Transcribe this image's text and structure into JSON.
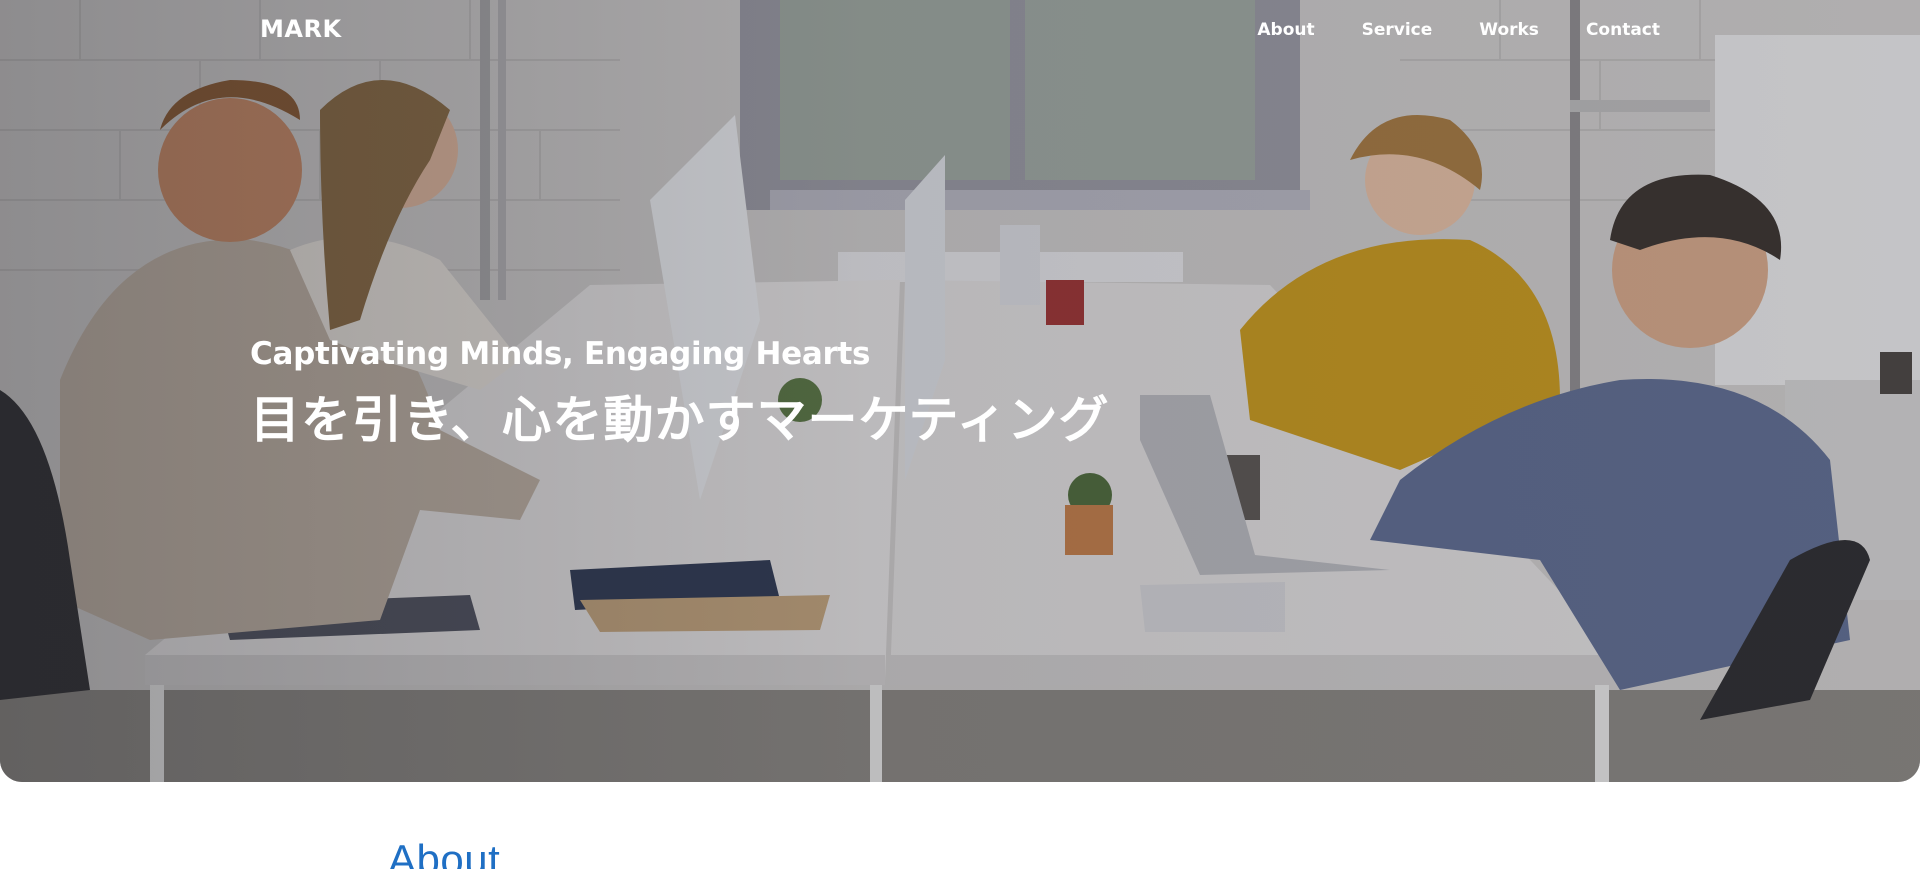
{
  "header": {
    "logo": "MARK",
    "nav": [
      {
        "label": "About"
      },
      {
        "label": "Service"
      },
      {
        "label": "Works"
      },
      {
        "label": "Contact"
      }
    ]
  },
  "hero": {
    "subtitle": "Captivating Minds, Engaging Hearts",
    "title": "目を引き、心を動かすマーケティング",
    "image": "office-coworkers-at-desks-photo"
  },
  "sections": {
    "about_heading": "About"
  },
  "colors": {
    "accent": "#1f6fc4",
    "nav_text": "#ffffff",
    "background": "#ffffff"
  }
}
